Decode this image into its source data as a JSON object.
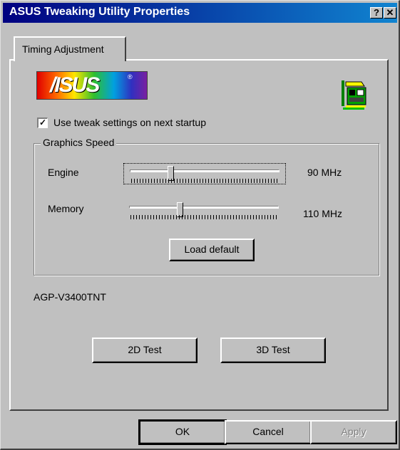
{
  "window": {
    "title": "ASUS Tweaking Utility Properties",
    "help_glyph": "?",
    "close_glyph": "✕"
  },
  "tabs": [
    {
      "label": "Timing Adjustment",
      "selected": true
    }
  ],
  "logo": {
    "text": "/ISUS",
    "tm": "®"
  },
  "tweak_checkbox": {
    "label": "Use tweak settings on next startup",
    "checked": true
  },
  "graphics_speed": {
    "label": "Graphics Speed",
    "engine": {
      "label": "Engine",
      "value": "90 MHz",
      "level": 0.27
    },
    "memory": {
      "label": "Memory",
      "value": "110 MHz",
      "level": 0.34
    },
    "load_default": "Load default"
  },
  "device_name": "AGP-V3400TNT",
  "tests": {
    "test_2d": "2D Test",
    "test_3d": "3D Test"
  },
  "footer": {
    "ok": "OK",
    "cancel": "Cancel",
    "apply": "Apply"
  }
}
